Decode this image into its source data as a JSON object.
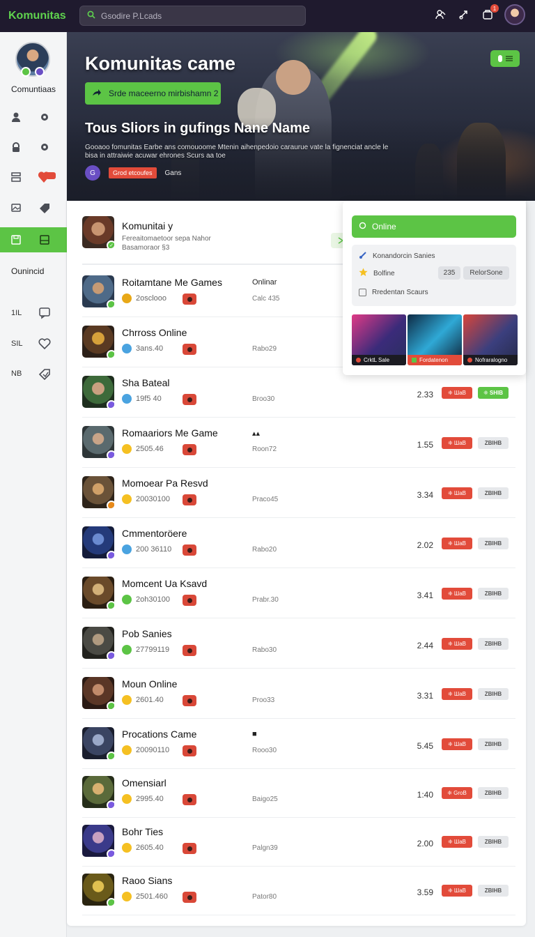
{
  "topbar": {
    "brand": "Komunitas",
    "search_placeholder": "Gsodire P.Lcads",
    "notification_count": "1"
  },
  "sidebar": {
    "user_name": "Comuntiaas",
    "section_label": "Ounincid",
    "rows": [
      {
        "label": "",
        "left_icon": "user-icon",
        "right_icon": "gear-icon",
        "active": false
      },
      {
        "label": "",
        "left_icon": "lock-icon",
        "right_icon": "gear-icon",
        "active": false
      },
      {
        "label": "",
        "left_icon": "grid-icon",
        "right_icon": "heart-icon",
        "active": false
      },
      {
        "label": "",
        "left_icon": "image-icon",
        "right_icon": "tag-icon",
        "active": false
      },
      {
        "label": "",
        "left_icon": "save-icon",
        "right_icon": "panel-icon",
        "active": true
      }
    ],
    "lower_rows": [
      {
        "label": "1IL",
        "icon": "chat-icon"
      },
      {
        "label": "SIL",
        "icon": "heart-icon"
      },
      {
        "label": "NB",
        "icon": "tag-icon"
      }
    ]
  },
  "hero": {
    "title": "Komunitas came",
    "cta_label": "Srde maceerno mirbishamn 2",
    "subtitle": "Tous Sliors in gufings Nane Name",
    "description": "Gooaoo fomunitas Earbe ans comouoome Mtenin aihenpedoio caraurue vate la fignenciat ancle le bisa in attraiwie acuwar ehrones Scurs aa toe",
    "tag": "Grod etcoufes",
    "meta_text": "Gans",
    "avatar_letter": "G"
  },
  "list_header": {
    "title": "Komunitai y",
    "sub1": "Fereaitomaetoor sepa Nahor",
    "sub2": "Basamoraor §3"
  },
  "popup": {
    "online_label": "Online",
    "line1": "Konandorcin Sanies",
    "line2": "Bolfine",
    "pill_count": "235",
    "pill_label": "RelorSone",
    "line3": "Rredentan Scaurs",
    "tiles": [
      "CrktL Sale",
      "Fordatenon",
      "Nofraralogno"
    ]
  },
  "rows": [
    {
      "title": "Roitamtane Me Games",
      "stat": "2osclooo",
      "info": "Onlinar",
      "meta": "Calc 435",
      "score": "",
      "red": "",
      "gray": "",
      "green": "",
      "stat_color": "#e8a817",
      "badge_color": "#5cc445"
    },
    {
      "title": "Chrross Online",
      "stat": "3ans.40",
      "info": "",
      "meta": "Rabo29",
      "score": "",
      "red": "",
      "gray": "",
      "green": "",
      "stat_color": "#4aa3e0",
      "badge_color": "#5cc445"
    },
    {
      "title": "Sha Bateal",
      "stat": "19f5 40",
      "info": "",
      "meta": "Broo30",
      "score": "2.33",
      "red": "❈ ШаВ",
      "gray": "",
      "green": "❈ SHIB",
      "stat_color": "#4aa3e0",
      "badge_color": "#7a5ae0"
    },
    {
      "title": "Romaariors Me Game",
      "stat": "2505.46",
      "info": "▴▴",
      "meta": "Roon72",
      "score": "1.55",
      "red": "❈ ШаВ",
      "gray": "ZBIHB",
      "green": "",
      "stat_color": "#f5c022",
      "badge_color": "#7a5ae0"
    },
    {
      "title": "Momoear Pa Resvd",
      "stat": "20030100",
      "info": "",
      "meta": "Praco45",
      "score": "3.34",
      "red": "❈ ШаВ",
      "gray": "ZBIHB",
      "green": "",
      "stat_color": "#f5c022",
      "badge_color": "#e88a1a"
    },
    {
      "title": "Cmmentoröere",
      "stat": "200 36110",
      "info": "",
      "meta": "Rabo20",
      "score": "2.02",
      "red": "❈ ШаВ",
      "gray": "ZBIHB",
      "green": "",
      "stat_color": "#4aa3e0",
      "badge_color": "#7a5ae0"
    },
    {
      "title": "Momcent Ua Ksavd",
      "stat": "2oh30100",
      "info": "",
      "meta": "Prabr.30",
      "score": "3.41",
      "red": "❈ ШаВ",
      "gray": "ZBIHB",
      "green": "",
      "stat_color": "#5cc445",
      "badge_color": "#5cc445"
    },
    {
      "title": "Pob Sanies",
      "stat": "27799119",
      "info": "",
      "meta": "Rabo30",
      "score": "2.44",
      "red": "❈ ШаВ",
      "gray": "ZBIHB",
      "green": "",
      "stat_color": "#5cc445",
      "badge_color": "#7a5ae0"
    },
    {
      "title": "Moun Online",
      "stat": "2601.40",
      "info": "",
      "meta": "Proo33",
      "score": "3.31",
      "red": "❈ ШаВ",
      "gray": "ZBIHB",
      "green": "",
      "stat_color": "#f5c022",
      "badge_color": "#5cc445"
    },
    {
      "title": "Procations Came",
      "stat": "20090110",
      "info": "■",
      "meta": "Rooo30",
      "score": "5.45",
      "red": "❈ ШаВ",
      "gray": "ZBIHB",
      "green": "",
      "stat_color": "#f5c022",
      "badge_color": "#5cc445"
    },
    {
      "title": "Omensiarl",
      "stat": "2995.40",
      "info": "",
      "meta": "Baigo25",
      "score": "1:40",
      "red": "❈ GroB",
      "gray": "ZBIHB",
      "green": "",
      "stat_color": "#f5c022",
      "badge_color": "#7a5ae0"
    },
    {
      "title": "Bohr Ties",
      "stat": "2605.40",
      "info": "",
      "meta": "Palgn39",
      "score": "2.00",
      "red": "❈ ШаВ",
      "gray": "ZBIHB",
      "green": "",
      "stat_color": "#f5c022",
      "badge_color": "#7a5ae0"
    },
    {
      "title": "Raoo Sians",
      "stat": "2501.460",
      "info": "",
      "meta": "Pator80",
      "score": "3.59",
      "red": "❈ ШаВ",
      "gray": "ZBIHB",
      "green": "",
      "stat_color": "#f5c022",
      "badge_color": "#5cc445"
    }
  ],
  "colors": {
    "accent_green": "#5cc445",
    "accent_red": "#e24b3a",
    "topbar_bg": "#1f1a2e"
  }
}
